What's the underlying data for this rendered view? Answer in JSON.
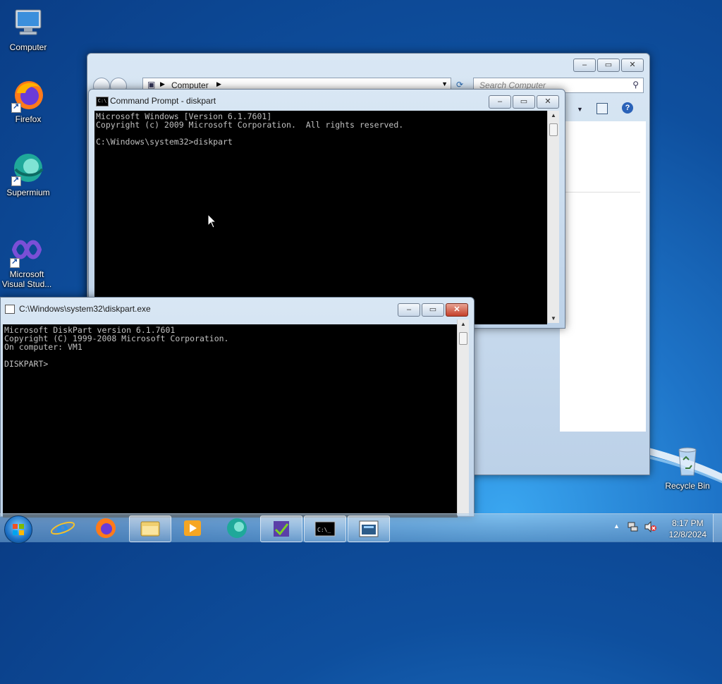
{
  "desktop": {
    "icons": [
      {
        "label": "Computer",
        "icon": "computer-icon"
      },
      {
        "label": "Firefox",
        "icon": "firefox-icon"
      },
      {
        "label": "Supermium",
        "icon": "supermium-icon"
      },
      {
        "label": "Microsoft Visual Stud...",
        "icon": "visual-studio-icon"
      },
      {
        "label": "Recycle Bin",
        "icon": "recycle-bin-icon"
      }
    ]
  },
  "explorer": {
    "breadcrumb": "Computer",
    "search_placeholder": "Search Computer"
  },
  "cmd": {
    "title": "Command Prompt - diskpart",
    "output": "Microsoft Windows [Version 6.1.7601]\nCopyright (c) 2009 Microsoft Corporation.  All rights reserved.\n\nC:\\Windows\\system32>diskpart"
  },
  "diskpart": {
    "title": "C:\\Windows\\system32\\diskpart.exe",
    "output": "Microsoft DiskPart version 6.1.7601\nCopyright (C) 1999-2008 Microsoft Corporation.\nOn computer: VM1\n\nDISKPART> "
  },
  "taskbar": {
    "apps": [
      "internet-explorer-icon",
      "firefox-icon",
      "windows-explorer-icon",
      "media-player-icon",
      "supermium-icon",
      "visual-studio-icon",
      "command-prompt-icon",
      "diskpart-icon"
    ],
    "time": "8:17 PM",
    "date": "12/8/2024"
  }
}
